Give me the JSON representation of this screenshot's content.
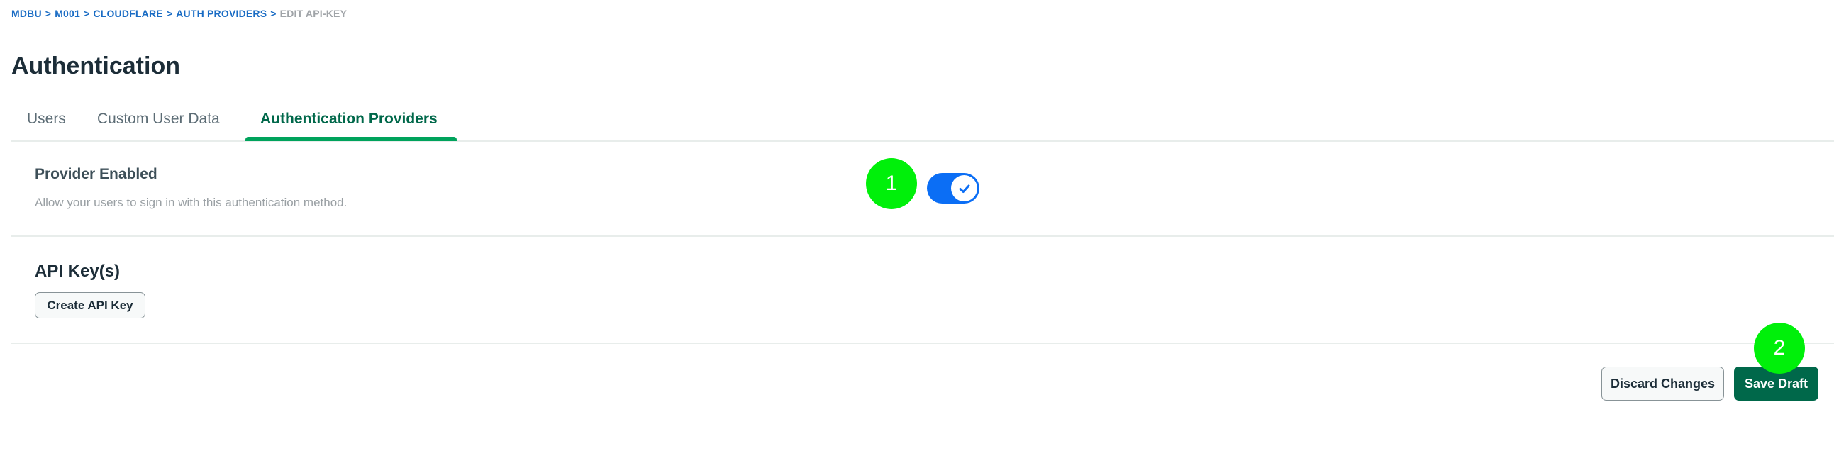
{
  "breadcrumb": {
    "items": [
      "MDBU",
      "M001",
      "CLOUDFLARE",
      "AUTH PROVIDERS"
    ],
    "separator": ">",
    "current": "EDIT API-KEY"
  },
  "page": {
    "title": "Authentication"
  },
  "tabs": [
    {
      "label": "Users",
      "active": false
    },
    {
      "label": "Custom User Data",
      "active": false
    },
    {
      "label": "Authentication Providers",
      "active": true
    }
  ],
  "provider": {
    "title": "Provider Enabled",
    "description": "Allow your users to sign in with this authentication method.",
    "enabled": true,
    "toggle_icon": "check-icon"
  },
  "api_keys": {
    "title": "API Key(s)",
    "create_label": "Create API Key"
  },
  "footer": {
    "discard_label": "Discard Changes",
    "save_label": "Save Draft"
  },
  "markers": [
    {
      "label": "1"
    },
    {
      "label": "2"
    }
  ],
  "colors": {
    "brand_green": "#00684a",
    "tab_underline": "#00a35c",
    "toggle_blue": "#0b6ef5",
    "link_blue": "#1a6cc4",
    "marker_green": "#00f00a"
  }
}
